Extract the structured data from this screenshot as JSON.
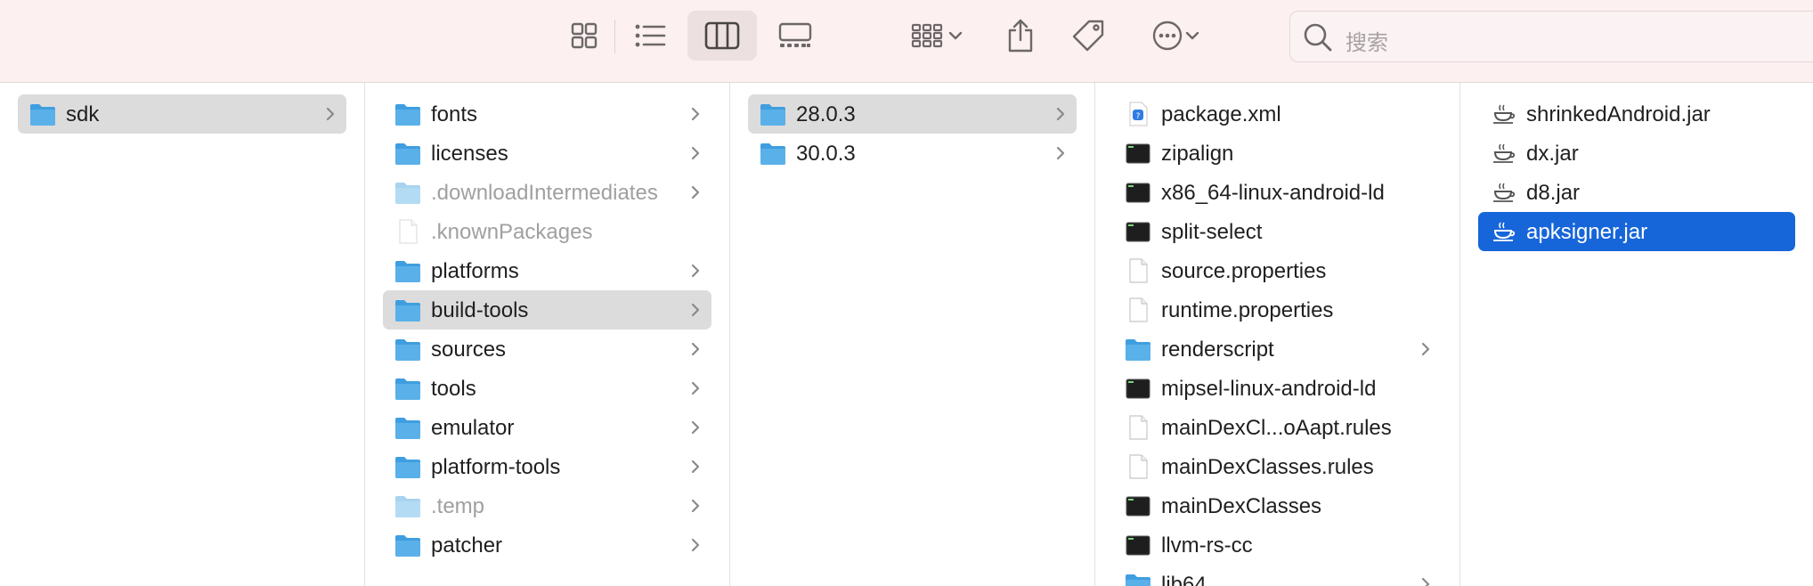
{
  "toolbar": {
    "view_icons": [
      "icon-view-icon",
      "list-view-icon",
      "column-view-icon",
      "gallery-view-icon"
    ],
    "active_view": "column-view-icon",
    "actions": [
      "group-icon",
      "share-icon",
      "tag-icon",
      "more-icon"
    ],
    "search_placeholder": "搜索"
  },
  "columns": [
    {
      "items": [
        {
          "name": "sdk",
          "kind": "folder",
          "has_children": true,
          "selected": "gray",
          "dim": false
        }
      ]
    },
    {
      "items": [
        {
          "name": "fonts",
          "kind": "folder",
          "has_children": true,
          "dim": false
        },
        {
          "name": "licenses",
          "kind": "folder",
          "has_children": true,
          "dim": false
        },
        {
          "name": ".downloadIntermediates",
          "kind": "folder",
          "has_children": true,
          "dim": true
        },
        {
          "name": ".knownPackages",
          "kind": "file",
          "has_children": false,
          "dim": true
        },
        {
          "name": "platforms",
          "kind": "folder",
          "has_children": true,
          "dim": false
        },
        {
          "name": "build-tools",
          "kind": "folder",
          "has_children": true,
          "selected": "gray",
          "dim": false
        },
        {
          "name": "sources",
          "kind": "folder",
          "has_children": true,
          "dim": false
        },
        {
          "name": "tools",
          "kind": "folder",
          "has_children": true,
          "dim": false
        },
        {
          "name": "emulator",
          "kind": "folder",
          "has_children": true,
          "dim": false
        },
        {
          "name": "platform-tools",
          "kind": "folder",
          "has_children": true,
          "dim": false
        },
        {
          "name": ".temp",
          "kind": "folder",
          "has_children": true,
          "dim": true
        },
        {
          "name": "patcher",
          "kind": "folder",
          "has_children": true,
          "dim": false
        }
      ]
    },
    {
      "items": [
        {
          "name": "28.0.3",
          "kind": "folder",
          "has_children": true,
          "selected": "gray",
          "dim": false
        },
        {
          "name": "30.0.3",
          "kind": "folder",
          "has_children": true,
          "dim": false
        }
      ]
    },
    {
      "items": [
        {
          "name": "package.xml",
          "kind": "xml",
          "has_children": false,
          "dim": false
        },
        {
          "name": "zipalign",
          "kind": "exec",
          "has_children": false,
          "dim": false
        },
        {
          "name": "x86_64-linux-android-ld",
          "kind": "exec",
          "has_children": false,
          "dim": false
        },
        {
          "name": "split-select",
          "kind": "exec",
          "has_children": false,
          "dim": false
        },
        {
          "name": "source.properties",
          "kind": "file",
          "has_children": false,
          "dim": false
        },
        {
          "name": "runtime.properties",
          "kind": "file",
          "has_children": false,
          "dim": false
        },
        {
          "name": "renderscript",
          "kind": "folder",
          "has_children": true,
          "dim": false
        },
        {
          "name": "mipsel-linux-android-ld",
          "kind": "exec",
          "has_children": false,
          "dim": false
        },
        {
          "name": "mainDexCl...oAapt.rules",
          "kind": "file",
          "has_children": false,
          "dim": false
        },
        {
          "name": "mainDexClasses.rules",
          "kind": "file",
          "has_children": false,
          "dim": false
        },
        {
          "name": "mainDexClasses",
          "kind": "exec",
          "has_children": false,
          "dim": false
        },
        {
          "name": "llvm-rs-cc",
          "kind": "exec",
          "has_children": false,
          "dim": false
        },
        {
          "name": "lib64",
          "kind": "folder",
          "has_children": true,
          "dim": false
        }
      ]
    },
    {
      "items": [
        {
          "name": "shrinkedAndroid.jar",
          "kind": "jar",
          "has_children": false,
          "dim": false
        },
        {
          "name": "dx.jar",
          "kind": "jar",
          "has_children": false,
          "dim": false
        },
        {
          "name": "d8.jar",
          "kind": "jar",
          "has_children": false,
          "dim": false
        },
        {
          "name": "apksigner.jar",
          "kind": "jar",
          "has_children": false,
          "selected": "blue",
          "dim": false
        }
      ]
    }
  ],
  "colors": {
    "toolbar_bg": "#fcf0f0",
    "selection_blue": "#1766d9",
    "selection_gray": "#dcdcdc",
    "folder": "#5ab0e8"
  }
}
